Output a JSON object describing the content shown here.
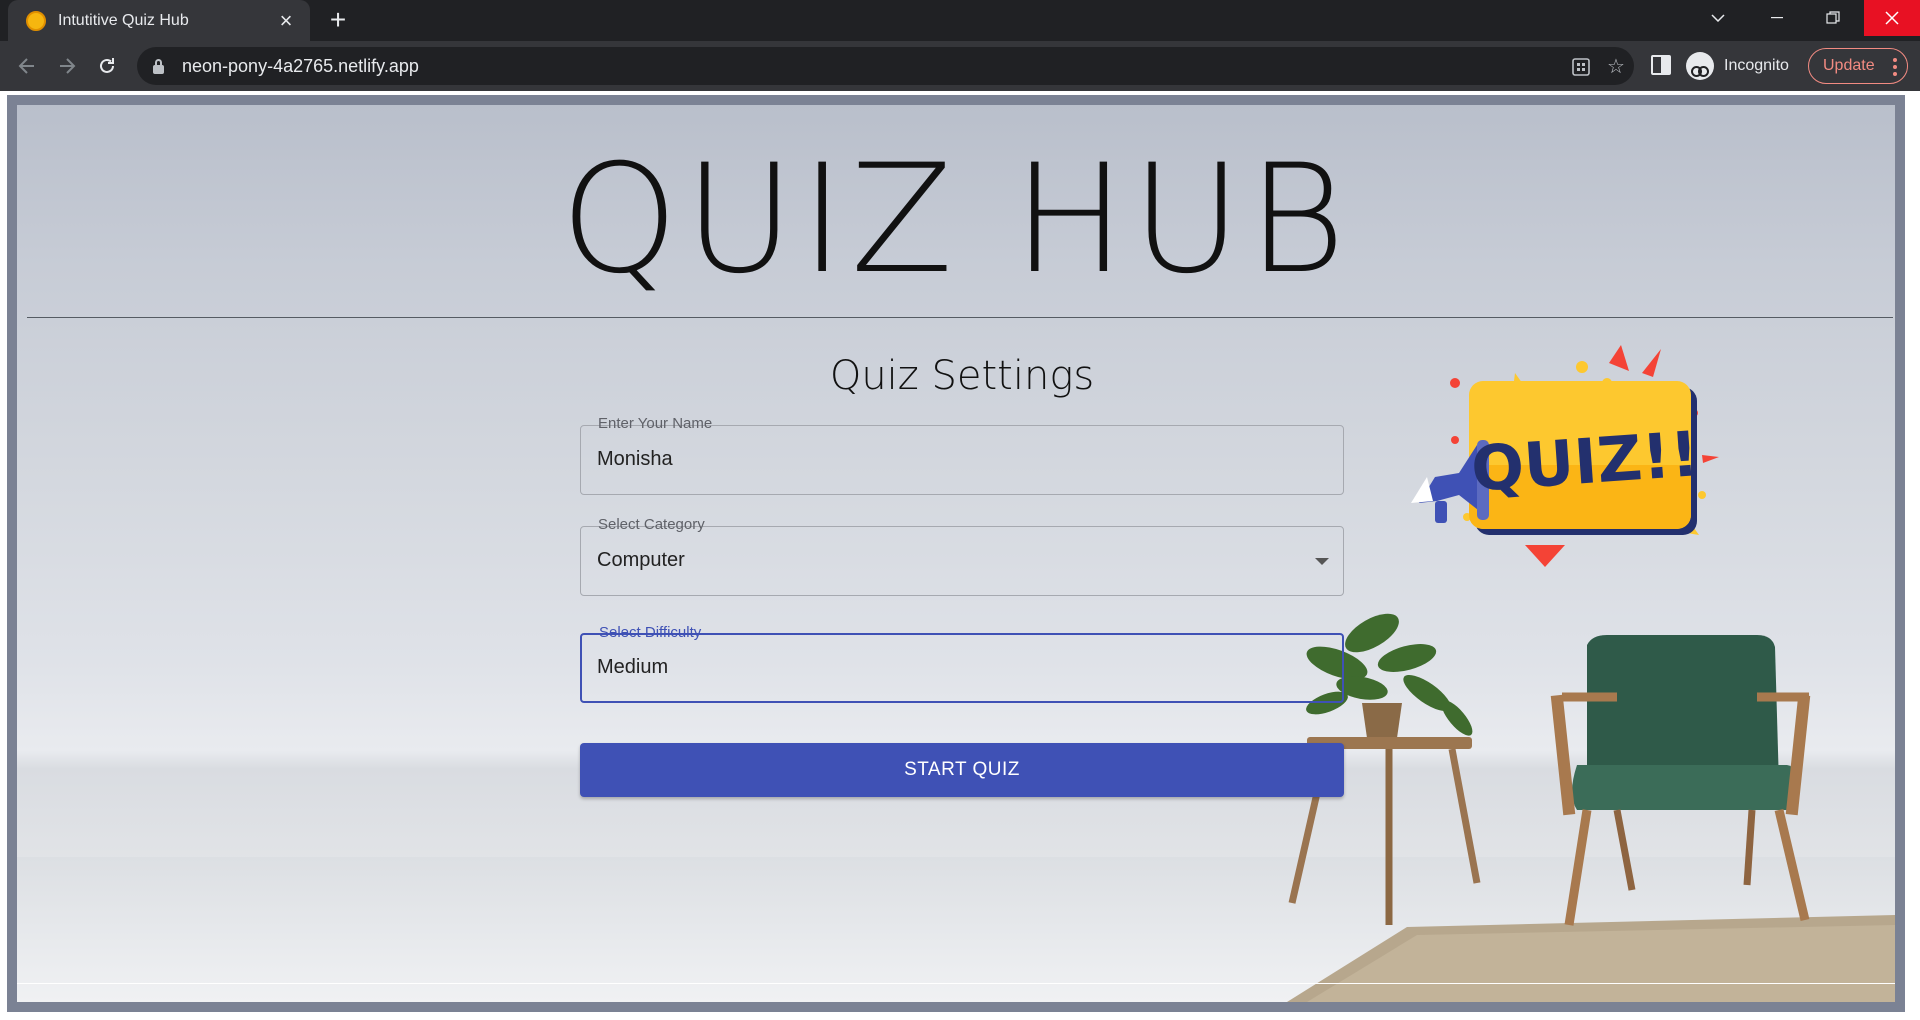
{
  "browser": {
    "tab_title": "Intutitive Quiz Hub",
    "url": "neon-pony-4a2765.netlify.app",
    "incognito_label": "Incognito",
    "update_label": "Update",
    "icons": [
      "back-icon",
      "forward-icon",
      "reload-icon",
      "lock-icon",
      "qr-icon",
      "star-icon",
      "side-panel-icon",
      "incognito-icon",
      "more-icon"
    ]
  },
  "page": {
    "title": "QUIZ HUB",
    "settings_title": "Quiz Settings",
    "name_field": {
      "label": "Enter Your Name",
      "value": "Monisha"
    },
    "category_field": {
      "label": "Select Category",
      "value": "Computer"
    },
    "difficulty_field": {
      "label": "Select Difficulty",
      "value": "Medium"
    },
    "start_button": "START QUIZ",
    "badge_text": "QUIZ!!"
  },
  "colors": {
    "primary": "#3f51b5",
    "badge_yellow": "#fdc82f",
    "badge_navy": "#23306e"
  }
}
